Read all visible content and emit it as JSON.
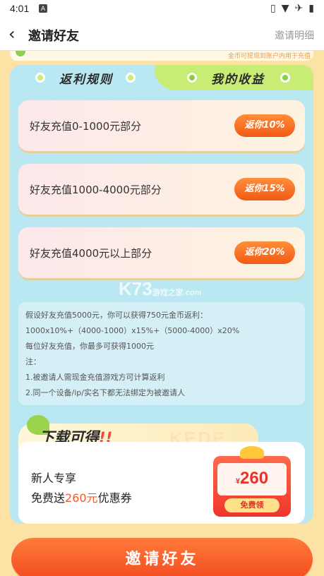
{
  "status_bar": {
    "time": "4:01",
    "a_badge": "A"
  },
  "navbar": {
    "back": "‹",
    "title": "邀请好友",
    "detail": "邀请明细"
  },
  "top_note": "金币可提现到账户内用于充值",
  "tabs": {
    "rule": "返利规则",
    "income": "我的收益"
  },
  "tiers": [
    {
      "label": "好友充值0-1000元部分",
      "badge": "返你10%"
    },
    {
      "label": "好友充值1000-4000元部分",
      "badge": "返你15%"
    },
    {
      "label": "好友充值4000元以上部分",
      "badge": "返你20%"
    }
  ],
  "rules": [
    "假设好友充值5000元，你可以获得750元金币返利：",
    "1000x10%+（4000-1000）x15%+（5000-4000）x20%",
    "每位好友充值，你最多可获得1000元",
    "注：",
    "1.被邀请人需现金充值游戏方可计算返利",
    "2.同一个设备/ip/实名下都无法绑定为被邀请人"
  ],
  "download": {
    "title": "下载可得",
    "title_mark": "!!",
    "ghost": "KEDE",
    "line1": "新人专享",
    "line2_prefix": "免费送",
    "line2_amount": "260元",
    "line2_suffix": "优惠券"
  },
  "coupon": {
    "currency": "¥",
    "amount": "260",
    "claim": "免费领"
  },
  "watermark": {
    "main": "K73",
    "sub": "游戏之家",
    "domain": ".com"
  },
  "invite_button": "邀请好友"
}
